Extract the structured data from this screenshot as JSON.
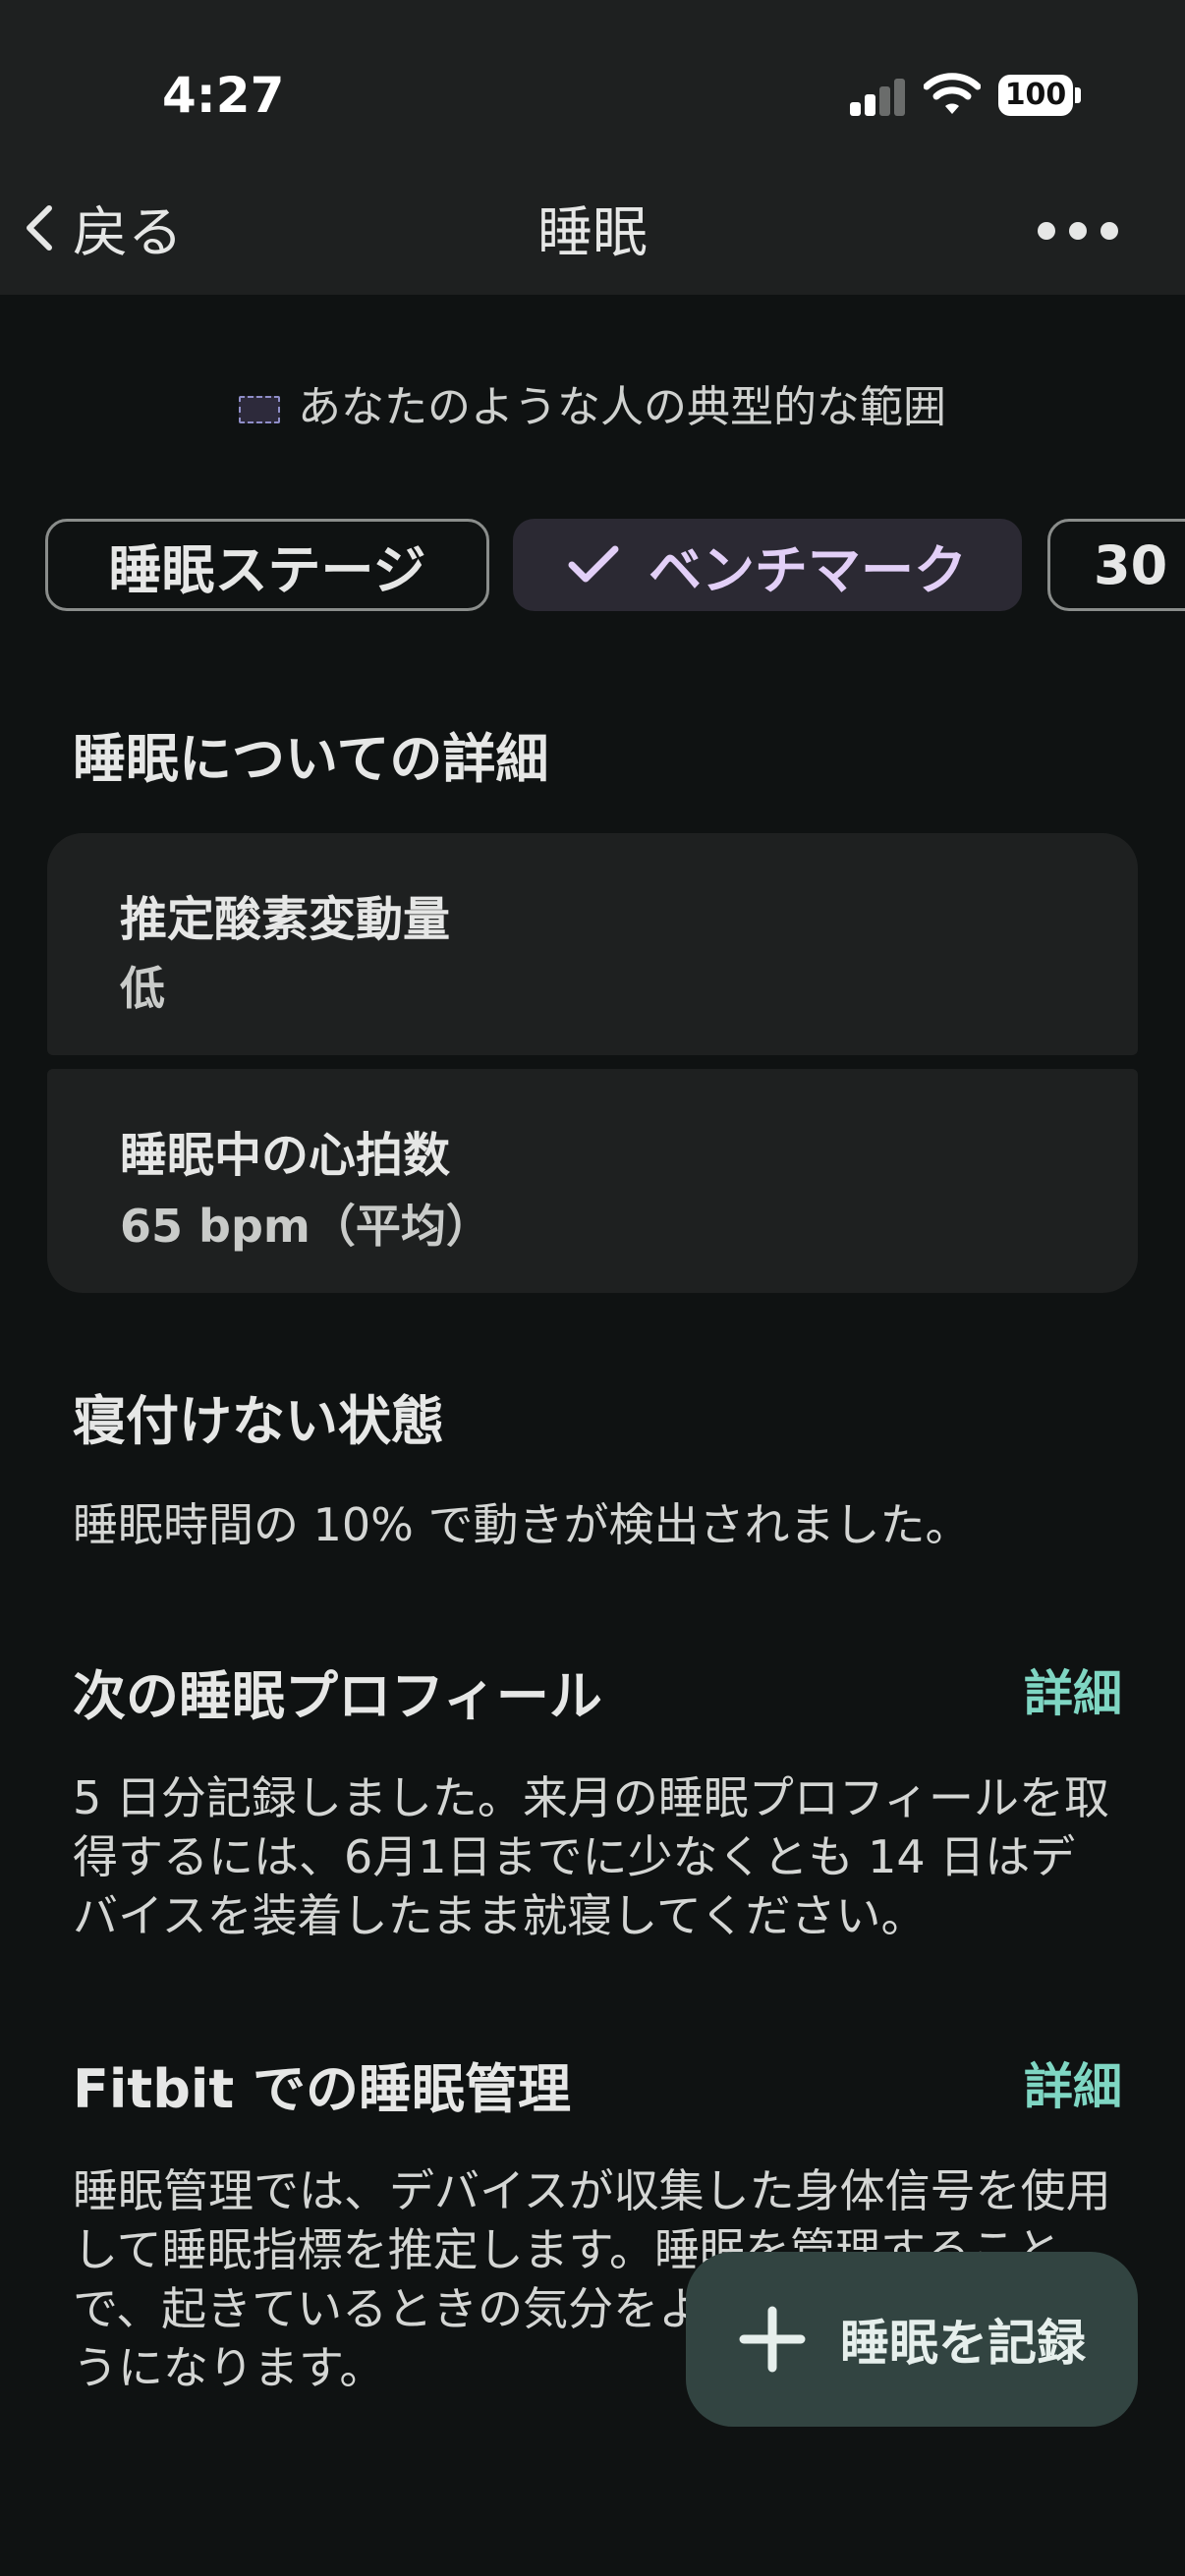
{
  "status_bar": {
    "time": "4:27",
    "battery": "100"
  },
  "nav": {
    "back_label": "戻る",
    "title": "睡眠"
  },
  "legend": {
    "text": "あなたのような人の典型的な範囲"
  },
  "chips": [
    {
      "label": "睡眠ステージ"
    },
    {
      "label": "ベンチマーク"
    },
    {
      "label": "30"
    }
  ],
  "details": {
    "title": "睡眠についての詳細",
    "oxygen_label": "推定酸素変動量",
    "oxygen_value": "低",
    "hr_label": "睡眠中の心拍数",
    "hr_value": "65 bpm（平均）"
  },
  "restless": {
    "title": "寝付けない状態",
    "text": "睡眠時間の 10% で動きが検出されました。"
  },
  "next_profile": {
    "title": "次の睡眠プロフィール",
    "link": "詳細",
    "text": "5 日分記録しました。来月の睡眠プロフィールを取得するには、6月1日までに少なくとも 14 日はデバイスを装着したまま就寝してください。"
  },
  "fitbit": {
    "title": "Fitbit での睡眠管理",
    "link": "詳細",
    "text": "睡眠管理では、デバイスが収集した身体信号を使用して睡眠指標を推定します。睡眠を管理することで、起きているときの気分をよりよく理解できるようになります。"
  },
  "fab": {
    "label": "睡眠を記録"
  },
  "colors": {
    "accent_teal": "#7fd6c3",
    "chip_selected_text": "#e2cff7",
    "fab_bg": "#324441"
  }
}
